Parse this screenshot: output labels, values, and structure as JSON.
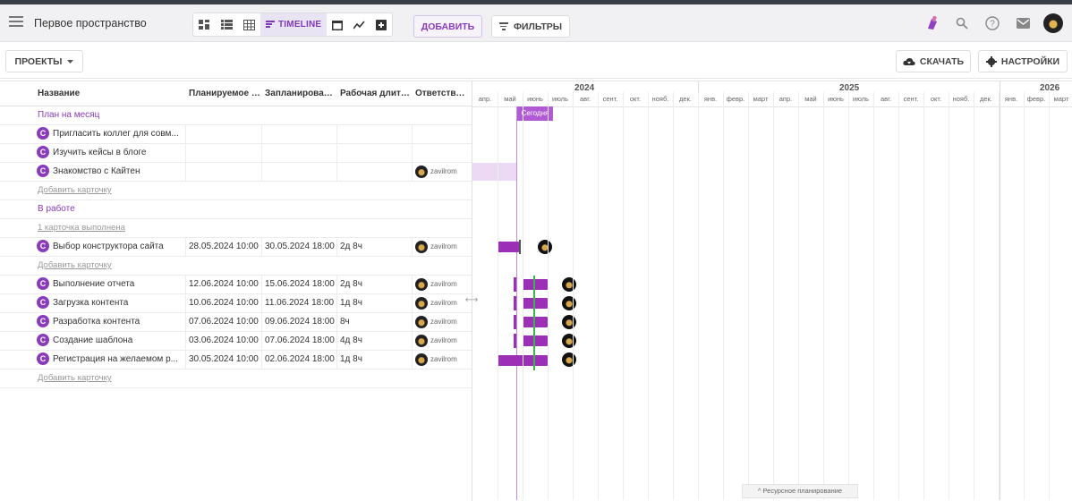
{
  "topbar": {
    "space_title": "Первое пространство",
    "timeline_label": "TIMELINE",
    "add_label": "ДОБАВИТЬ",
    "filters_label": "ФИЛЬТРЫ"
  },
  "toolbar": {
    "projects_label": "ПРОЕКТЫ",
    "download_label": "СКАЧАТЬ",
    "settings_label": "НАСТРОЙКИ"
  },
  "table": {
    "headers": [
      "Название",
      "Планируемое н...",
      "Запланирован...",
      "Рабочая длите...",
      "Ответствен..."
    ],
    "groups": [
      {
        "title": "План на месяц",
        "rows": [
          {
            "badge": "C",
            "name": "Пригласить коллег для совм...",
            "planned_start": "",
            "planned_end": "",
            "duration": "",
            "responsible": ""
          },
          {
            "badge": "C",
            "name": "Изучить кейсы в блоге",
            "planned_start": "",
            "planned_end": "",
            "duration": "",
            "responsible": ""
          },
          {
            "badge": "C",
            "name": "Знакомство с Кайтен",
            "planned_start": "",
            "planned_end": "",
            "duration": "",
            "responsible": "zavilrom"
          }
        ],
        "add_card": "Добавить карточку"
      },
      {
        "title": "В работе",
        "done_link": "1 карточка выполнена",
        "rows": [
          {
            "badge": "C",
            "name": "Выбор конструктора сайта",
            "planned_start": "28.05.2024 10:00",
            "planned_end": "30.05.2024 18:00",
            "duration": "2д 8ч",
            "responsible": "zavilrom"
          }
        ],
        "add_card": "Добавить карточку"
      },
      {
        "title": "",
        "rows": [
          {
            "badge": "C",
            "name": "Выполнение отчета",
            "planned_start": "12.06.2024 10:00",
            "planned_end": "15.06.2024 18:00",
            "duration": "2д 8ч",
            "responsible": "zavilrom"
          },
          {
            "badge": "C",
            "name": "Загрузка контента",
            "planned_start": "10.06.2024 10:00",
            "planned_end": "11.06.2024 18:00",
            "duration": "1д 8ч",
            "responsible": "zavilrom"
          },
          {
            "badge": "C",
            "name": "Разработка контента",
            "planned_start": "07.06.2024 10:00",
            "planned_end": "09.06.2024 18:00",
            "duration": "8ч",
            "responsible": "zavilrom"
          },
          {
            "badge": "C",
            "name": "Создание шаблона",
            "planned_start": "03.06.2024 10:00",
            "planned_end": "07.06.2024 18:00",
            "duration": "4д 8ч",
            "responsible": "zavilrom"
          },
          {
            "badge": "C",
            "name": "Регистрация на желаемом р...",
            "planned_start": "30.05.2024 10:00",
            "planned_end": "02.06.2024 18:00",
            "duration": "1д 8ч",
            "responsible": "zavilrom"
          }
        ],
        "add_card": "Добавить карточку"
      }
    ]
  },
  "gantt": {
    "years": [
      "2024",
      "2025",
      "2026"
    ],
    "months_2024": [
      "апр.",
      "май",
      "июнь",
      "июль",
      "авг.",
      "сент.",
      "окт.",
      "нояб.",
      "дек."
    ],
    "months_2025": [
      "янв.",
      "февр.",
      "март",
      "апр.",
      "май",
      "июнь",
      "июль",
      "авг.",
      "сент.",
      "окт.",
      "нояб.",
      "дек."
    ],
    "months_2026": [
      "янв.",
      "февр.",
      "март"
    ],
    "today_label": "Сегодня",
    "resource_label": "Ресурсное планирование",
    "accent": "#9b2fb5",
    "progress_color": "#3bb54a"
  },
  "icons": {
    "menu": "hamburger-icon",
    "search": "search-icon",
    "help": "help-icon",
    "mail": "mail-icon",
    "download": "cloud-download-icon",
    "settings": "gear-icon"
  }
}
